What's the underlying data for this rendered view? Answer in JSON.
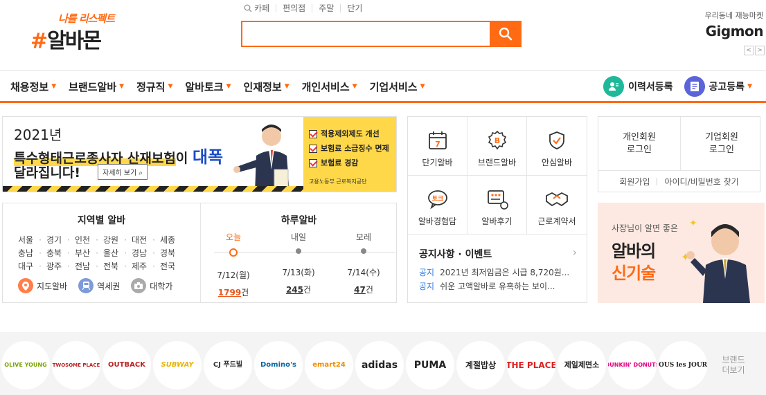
{
  "header": {
    "logo_slogan": "나를 리스펙트",
    "logo_hash": "#",
    "logo_name": "알바몬",
    "quick_links": [
      "카페",
      "편의점",
      "주말",
      "단기"
    ],
    "search_placeholder": "",
    "gigmon_sub": "우리동네 재능마켓",
    "gigmon_name": "Gigmon",
    "prev_arrow": "<",
    "next_arrow": ">"
  },
  "nav": {
    "items": [
      "채용정보",
      "브랜드알바",
      "정규직",
      "알바토크",
      "인재정보",
      "개인서비스",
      "기업서비스"
    ],
    "resume_label": "이력서등록",
    "post_label": "공고등록",
    "chevron": "⌄"
  },
  "banner": {
    "line1": "2021년",
    "line2_highlight": "특수형태근로종사자 산재보험",
    "line2_rest": "이 ",
    "line2_big": "대폭",
    "line3": "달라집니다!",
    "detail_button": "자세히 보기",
    "checks": [
      "적용제외제도 개선",
      "보험료 소급징수 면제",
      "보험료 경감"
    ],
    "orgs": "고용노동부   근로복지공단"
  },
  "region": {
    "title": "지역별 알바",
    "areas": [
      "서울",
      "경기",
      "인천",
      "강원",
      "대전",
      "세종",
      "충남",
      "충북",
      "부산",
      "울산",
      "경남",
      "경북",
      "대구",
      "광주",
      "전남",
      "전북",
      "제주",
      "전국"
    ],
    "links": [
      "지도알바",
      "역세권",
      "대학가"
    ]
  },
  "daily": {
    "title": "하루알바",
    "days": [
      {
        "label": "오늘",
        "date": "7/12(월)",
        "count": "1799",
        "unit": "건"
      },
      {
        "label": "내일",
        "date": "7/13(화)",
        "count": "245",
        "unit": "건"
      },
      {
        "label": "모레",
        "date": "7/14(수)",
        "count": "47",
        "unit": "건"
      }
    ]
  },
  "icon_grid": {
    "items": [
      "단기알바",
      "브랜드알바",
      "안심알바",
      "알바경험담",
      "알바후기",
      "근로계약서"
    ],
    "calendar_num": "7",
    "brand_letter": "B",
    "talk_text": "토크"
  },
  "notice": {
    "title": "공지사항 · 이벤트",
    "arrow": "›",
    "rows": [
      {
        "tag": "공지",
        "text": "2021년 최저임금은 시급 8,720원..."
      },
      {
        "tag": "공지",
        "text": "쉬운 고액알바로 유혹하는 보이..."
      }
    ]
  },
  "login": {
    "personal": "개인회원\n로그인",
    "personal_l1": "개인회원",
    "personal_l2": "로그인",
    "company_l1": "기업회원",
    "company_l2": "로그인",
    "join": "회원가입",
    "find": "아이디/비밀번호 찾기"
  },
  "ad": {
    "line1": "사장님이 알면 좋은",
    "line2": "알바의",
    "line3": "신기술"
  },
  "brands": {
    "items": [
      "OLIVE YOUNG",
      "TWOSOME PLACE",
      "OUTBACK",
      "SUBWAY",
      "CJ 푸드빌",
      "Domino's",
      "emart24",
      "adidas",
      "PUMA",
      "계절밥상",
      "THE PLACE",
      "제일제면소",
      "DUNKIN' DONUTS",
      "TOUS les JOURS"
    ],
    "more_l1": "브랜드",
    "more_l2": "더보기"
  },
  "colors": {
    "accent": "#ff6a13",
    "resume_icon": "#1fb99a",
    "post_icon": "#5b64d8",
    "notice_tag": "#2b7be4"
  }
}
